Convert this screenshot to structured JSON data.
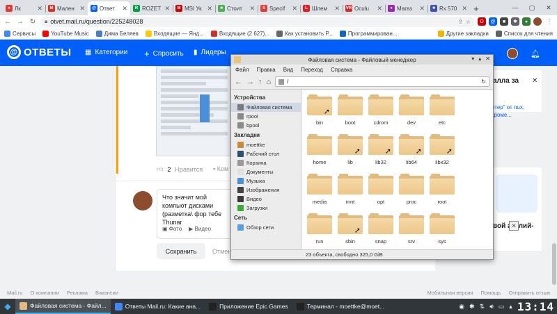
{
  "browser": {
    "tabs": [
      {
        "label": "Лк",
        "color": "#e53935",
        "glyph": "●",
        "active": false
      },
      {
        "label": "Мален",
        "color": "#d93025",
        "glyph": "M",
        "active": false
      },
      {
        "label": "Ответ",
        "color": "#005ff9",
        "glyph": "@",
        "active": true
      },
      {
        "label": "ROZET",
        "color": "#00a046",
        "glyph": "R",
        "active": false
      },
      {
        "label": "MSI Ук",
        "color": "#cc0000",
        "glyph": "M",
        "active": false
      },
      {
        "label": "Стоит",
        "color": "#4caf50",
        "glyph": "■",
        "active": false
      },
      {
        "label": "Specif",
        "color": "#e53935",
        "glyph": "S",
        "active": false
      },
      {
        "label": "Шлем",
        "color": "#e31e24",
        "glyph": "L",
        "active": false
      },
      {
        "label": "Oculu",
        "color": "#d32f2f",
        "glyph": "VR",
        "active": false
      },
      {
        "label": "Магаз",
        "color": "#9c27b0",
        "glyph": "●",
        "active": false
      },
      {
        "label": "Rx 570",
        "color": "#3f51b5",
        "glyph": "■",
        "active": false
      }
    ],
    "url": "otvet.mail.ru/question/225248028",
    "bookmarks": [
      {
        "label": "Сервисы",
        "color": "#4285f4"
      },
      {
        "label": "YouTube Music",
        "color": "#ff0000"
      },
      {
        "label": "Дима Беляев",
        "color": "#4680c2"
      },
      {
        "label": "Входящие — Янд...",
        "color": "#ffcc00"
      },
      {
        "label": "Входящие (2 627)...",
        "color": "#d93025"
      },
      {
        "label": "Как установить Р...",
        "color": "#666666"
      },
      {
        "label": "Программирован...",
        "color": "#1565c0"
      }
    ],
    "bookmarks_right": [
      "Другие закладки",
      "Список для чтения"
    ]
  },
  "otvety": {
    "logo": "ОТВЕТЫ",
    "nav": {
      "categories": "Категории",
      "ask": "Спросить",
      "leaders": "Лидеры"
    },
    "likes_count": "2",
    "likes_label": "Нравится",
    "comment_label": "Ком",
    "reply_text": "Что значит мой компьют дисками (разметка\\ фор тебе Thunar",
    "photo": "Фото",
    "video": "Видео",
    "save": "Сохранить",
    "cancel": "Отмен",
    "right_title": "алла за",
    "right_text": "отер\" от nux, кроме...",
    "right_ad": "вой англий-",
    "footer_left": [
      "Mail.ru",
      "О компании",
      "Реклама",
      "Вакансии"
    ],
    "footer_right": [
      "Мобильная версия",
      "Помощь",
      "Отправить отзыв"
    ]
  },
  "filemanager": {
    "title": "Файловая система - Файловый менеджер",
    "menu": [
      "Файл",
      "Правка",
      "Вид",
      "Переход",
      "Справка"
    ],
    "path": "/",
    "sidebar": {
      "devices_header": "Устройства",
      "devices": [
        {
          "label": "Файловая система",
          "selected": true,
          "color": "#7a7a7a"
        },
        {
          "label": "rpool",
          "selected": false,
          "color": "#8a8a8a"
        },
        {
          "label": "bpool",
          "selected": false,
          "color": "#8a8a8a"
        }
      ],
      "places_header": "Закладки",
      "places": [
        {
          "label": "moettke",
          "color": "#c98a3a"
        },
        {
          "label": "Рабочий стол",
          "color": "#2f4f6f"
        },
        {
          "label": "Корзина",
          "color": "#9a9a9a"
        },
        {
          "label": "Документы",
          "color": "#e0e0e0"
        },
        {
          "label": "Музыка",
          "color": "#4a90d9"
        },
        {
          "label": "Изображения",
          "color": "#444444"
        },
        {
          "label": "Видео",
          "color": "#3a3a3a"
        },
        {
          "label": "Загрузки",
          "color": "#3daa3a"
        }
      ],
      "network_header": "Сеть",
      "network": [
        {
          "label": "Обзор сети",
          "color": "#5aa0e0"
        }
      ]
    },
    "folders": [
      {
        "name": "bin",
        "link": true
      },
      {
        "name": "boot",
        "link": false
      },
      {
        "name": "cdrom",
        "link": false
      },
      {
        "name": "dev",
        "link": false
      },
      {
        "name": "etc",
        "link": false
      },
      {
        "name": "home",
        "link": false
      },
      {
        "name": "lib",
        "link": true
      },
      {
        "name": "lib32",
        "link": true
      },
      {
        "name": "lib64",
        "link": true
      },
      {
        "name": "libx32",
        "link": true
      },
      {
        "name": "media",
        "link": false
      },
      {
        "name": "mnt",
        "link": false
      },
      {
        "name": "opt",
        "link": false
      },
      {
        "name": "proc",
        "link": false
      },
      {
        "name": "root",
        "link": false
      },
      {
        "name": "run",
        "link": false
      },
      {
        "name": "sbin",
        "link": true
      },
      {
        "name": "snap",
        "link": false
      },
      {
        "name": "srv",
        "link": false
      },
      {
        "name": "sys",
        "link": false
      }
    ],
    "status": "23 объекта, свободно 325,0 GiB"
  },
  "taskbar": {
    "tasks": [
      {
        "label": "Файловая система - Файл...",
        "active": true,
        "color": "#e1bb80"
      },
      {
        "label": "Ответы Mail.ru: Какие ана...",
        "active": false,
        "color": "#4285f4"
      },
      {
        "label": "Приложение Epic Games",
        "active": false,
        "color": "#222222"
      },
      {
        "label": "Терминал - moettke@moet...",
        "active": false,
        "color": "#222222"
      }
    ],
    "clock": "13:14"
  }
}
